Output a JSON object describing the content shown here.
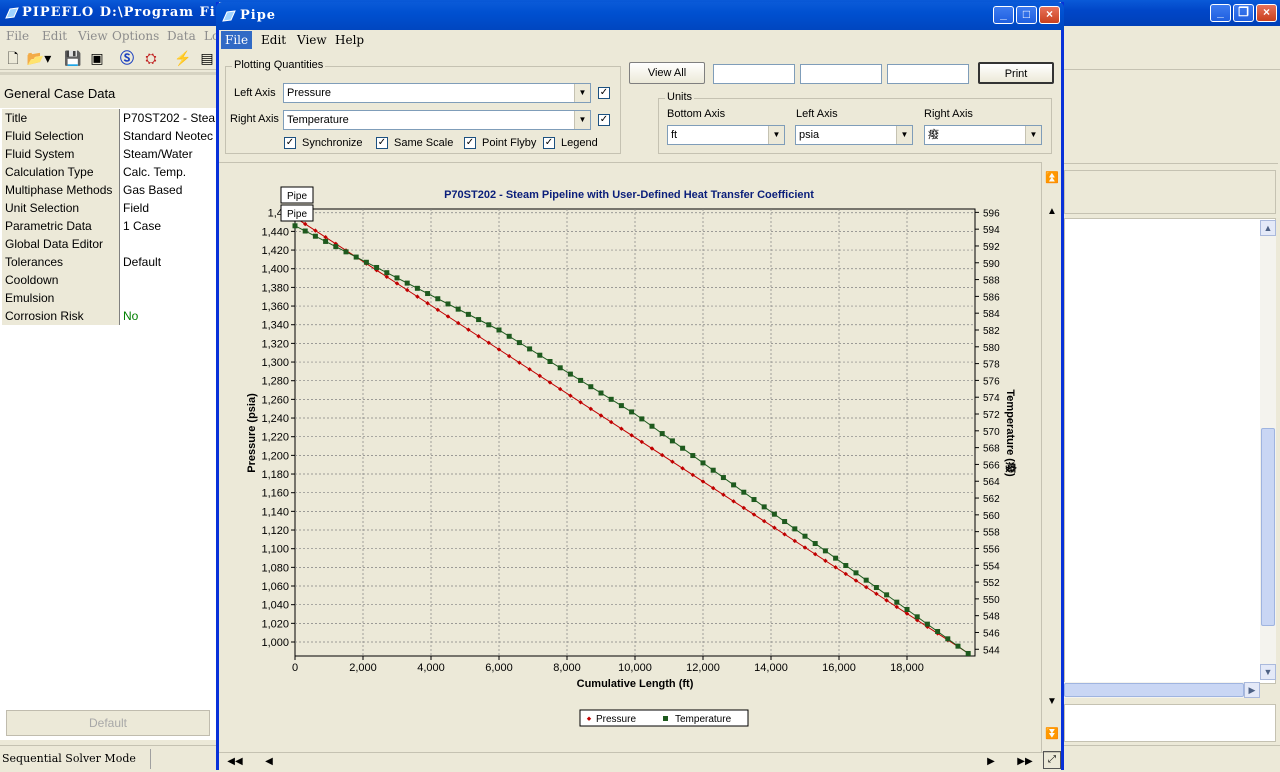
{
  "main": {
    "title": "PIPEFLO  D:\\Program Fil",
    "menu": [
      "File",
      "Edit",
      "View",
      "Options",
      "Data",
      "Lo"
    ],
    "left_header": "General Case Data",
    "properties": [
      {
        "key": "Title",
        "value": "P70ST202 - Stea"
      },
      {
        "key": "Fluid Selection",
        "value": "Standard Neotec"
      },
      {
        "key": "Fluid System",
        "value": "Steam/Water"
      },
      {
        "key": "Calculation Type",
        "value": "Calc. Temp."
      },
      {
        "key": "Multiphase Methods",
        "value": "Gas Based"
      },
      {
        "key": "Unit Selection",
        "value": "Field"
      },
      {
        "key": "Parametric Data",
        "value": "1 Case"
      },
      {
        "key": "Global Data Editor",
        "value": ""
      },
      {
        "key": "Tolerances",
        "value": "Default"
      },
      {
        "key": "Cooldown",
        "value": ""
      },
      {
        "key": "Emulsion",
        "value": ""
      },
      {
        "key": "Corrosion Risk",
        "value": "No"
      }
    ],
    "corrosion_value_color": "#008000",
    "default_button": "Default",
    "status": "Sequential Solver Mode"
  },
  "pipe": {
    "title": "Pipe",
    "menu": [
      "File",
      "Edit",
      "View",
      "Help"
    ],
    "plotting_quantities": "Plotting Quantities",
    "left_axis_label": "Left Axis",
    "left_axis_value": "Pressure",
    "right_axis_label": "Right Axis",
    "right_axis_value": "Temperature",
    "options": [
      "Synchronize",
      "Same Scale",
      "Point Flyby",
      "Legend"
    ],
    "view_all": "View All",
    "print": "Print",
    "units_title": "Units",
    "units": [
      {
        "label": "Bottom Axis",
        "value": "ft"
      },
      {
        "label": "Left Axis",
        "value": "psia"
      },
      {
        "label": "Right Axis",
        "value": "癈"
      }
    ]
  },
  "chart_data": {
    "type": "line",
    "title": "P70ST202 - Steam Pipeline with User-Defined Heat Transfer Coefficient",
    "xlabel": "Cumulative Length (ft)",
    "ylabel": "Pressure (psia)",
    "y2label": "Temperature (癈)",
    "xlim": [
      0,
      20000
    ],
    "ylim": [
      985,
      1464
    ],
    "y2lim": [
      543.2,
      596.4
    ],
    "x_ticks": [
      "0",
      "2,000",
      "4,000",
      "6,000",
      "8,000",
      "10,000",
      "12,000",
      "14,000",
      "16,000",
      "18,000"
    ],
    "y_ticks": [
      "1,000",
      "1,020",
      "1,040",
      "1,060",
      "1,080",
      "1,100",
      "1,120",
      "1,140",
      "1,160",
      "1,180",
      "1,200",
      "1,220",
      "1,240",
      "1,260",
      "1,280",
      "1,300",
      "1,320",
      "1,340",
      "1,360",
      "1,380",
      "1,400",
      "1,420",
      "1,440",
      "1,46"
    ],
    "y2_ticks": [
      "544",
      "546",
      "548",
      "550",
      "552",
      "554",
      "556",
      "558",
      "560",
      "562",
      "564",
      "566",
      "568",
      "570",
      "572",
      "574",
      "576",
      "578",
      "580",
      "582",
      "584",
      "586",
      "588",
      "590",
      "592",
      "594",
      "596"
    ],
    "grid": true,
    "legend_position": "bottom",
    "pipe_labels": [
      "Pipe",
      "Pipe"
    ],
    "series": [
      {
        "name": "Pressure",
        "axis": "left",
        "color": "#c00000",
        "marker": "diamond",
        "x": [
          0,
          19800
        ],
        "values": [
          1455,
          988
        ]
      },
      {
        "name": "Temperature",
        "axis": "right",
        "color": "#1e5a1e",
        "marker": "square",
        "x": [
          0,
          6000,
          10000,
          19800
        ],
        "values": [
          594.4,
          582,
          572,
          543.5
        ]
      }
    ]
  }
}
